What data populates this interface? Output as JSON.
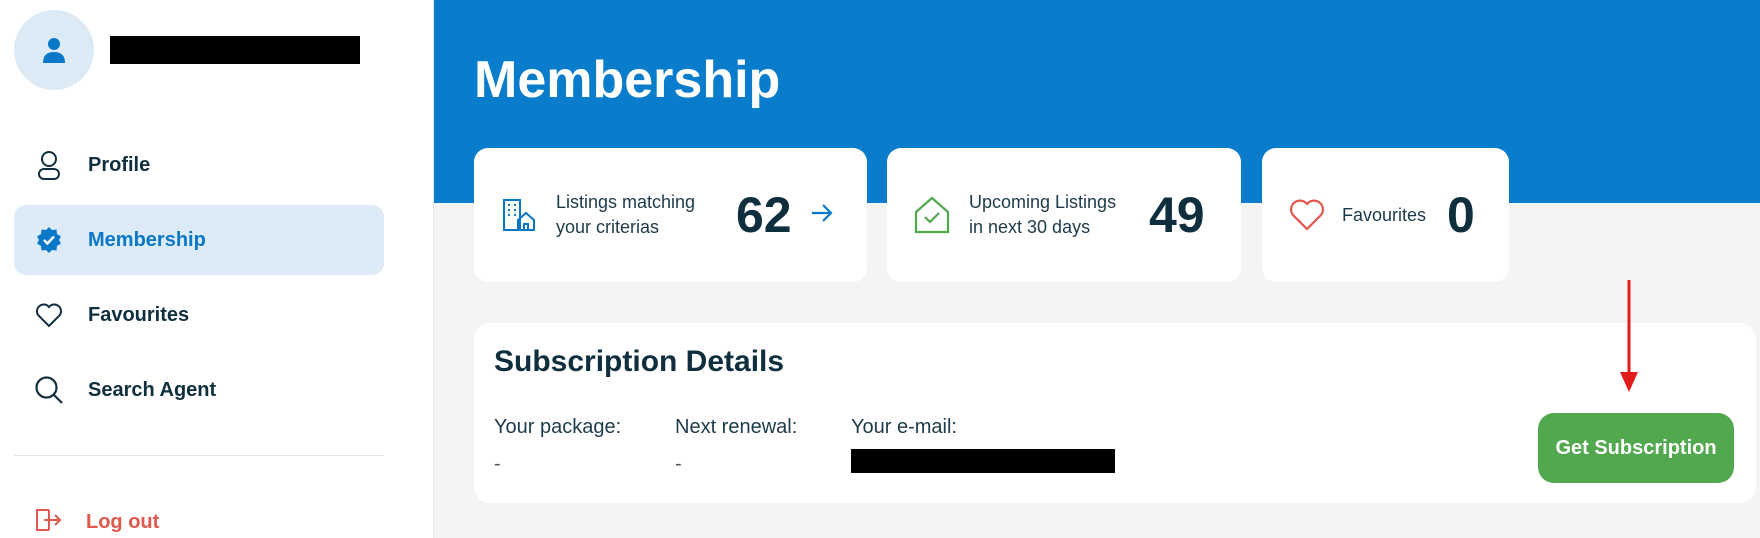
{
  "sidebar": {
    "nav": [
      {
        "label": "Profile",
        "icon": "person-icon"
      },
      {
        "label": "Membership",
        "icon": "verified-badge-icon",
        "active": true
      },
      {
        "label": "Favourites",
        "icon": "heart-icon"
      },
      {
        "label": "Search Agent",
        "icon": "search-icon"
      }
    ],
    "logout_label": "Log out"
  },
  "main": {
    "title": "Membership",
    "stats": [
      {
        "label_line1": "Listings matching",
        "label_line2": "your criterias",
        "value": "62",
        "icon": "buildings-icon"
      },
      {
        "label_line1": "Upcoming Listings",
        "label_line2": "in next 30 days",
        "value": "49",
        "icon": "house-check-icon"
      },
      {
        "label_line1": "Favourites",
        "value": "0",
        "icon": "heart-icon"
      }
    ],
    "subscription": {
      "title": "Subscription Details",
      "package_label": "Your package:",
      "package_value": "-",
      "renewal_label": "Next renewal:",
      "renewal_value": "-",
      "email_label": "Your e-mail:",
      "button_label": "Get Subscription"
    }
  },
  "colors": {
    "brand_blue": "#0a7ccc",
    "active_bg": "#dcebf7",
    "success_green": "#52a84e",
    "danger_red": "#e2574c",
    "annotation_arrow": "#e31b1b"
  }
}
